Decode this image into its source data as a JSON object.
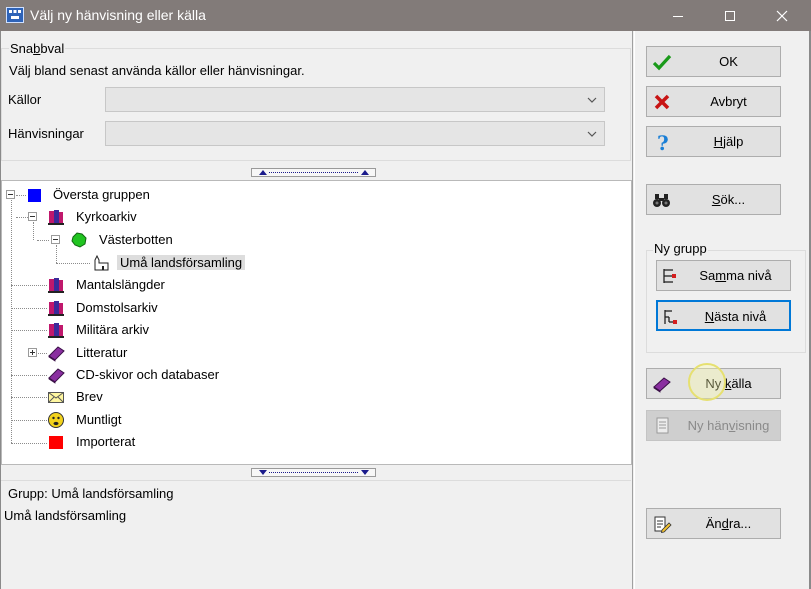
{
  "window": {
    "title": "Välj ny hänvisning eller källa"
  },
  "snabbval": {
    "legend_before": "Sna",
    "legend_mnemonic": "b",
    "legend_after": "bval",
    "hint": "Välj bland senast använda källor eller hänvisningar.",
    "kallor_label": "Källor",
    "kallor_value": "",
    "hanvisningar_label": "Hänvisningar",
    "hanvisningar_value": ""
  },
  "tree": {
    "items": [
      {
        "label": "Översta gruppen",
        "icon": "blue-square-icon"
      },
      {
        "label": "Kyrkoarkiv",
        "icon": "books-icon"
      },
      {
        "label": "Västerbotten",
        "icon": "region-map-icon"
      },
      {
        "label": "Umå landsförsamling",
        "icon": "church-icon"
      },
      {
        "label": "Mantalslängder",
        "icon": "books-icon"
      },
      {
        "label": "Domstolsarkiv",
        "icon": "books-icon"
      },
      {
        "label": "Militära arkiv",
        "icon": "books-icon"
      },
      {
        "label": "Litteratur",
        "icon": "book-icon"
      },
      {
        "label": "CD-skivor och databaser",
        "icon": "book-icon"
      },
      {
        "label": "Brev",
        "icon": "envelope-icon"
      },
      {
        "label": "Muntligt",
        "icon": "face-icon"
      },
      {
        "label": "Importerat",
        "icon": "red-square-icon"
      }
    ]
  },
  "info": {
    "group_line": "Grupp: Umå landsförsamling",
    "detail": "Umå landsförsamling"
  },
  "buttons": {
    "ok": "OK",
    "avbryt": "Avbryt",
    "hjalp_mnemonic": "H",
    "hjalp_rest": "jälp",
    "sok_mnemonic": "S",
    "sok_rest": "ök...",
    "nygrupp_legend": "Ny grupp",
    "samma_before": "Sa",
    "samma_mnemonic": "m",
    "samma_after": "ma nivå",
    "nasta_before": "",
    "nasta_mnemonic": "N",
    "nasta_after": "ästa nivå",
    "nykalla_before": "Ny ",
    "nykalla_mnemonic": "k",
    "nykalla_after": "älla",
    "nyhanv_before": "Ny hän",
    "nyhanv_mnemonic": "v",
    "nyhanv_after": "isning",
    "andra_before": "Än",
    "andra_mnemonic": "d",
    "andra_after": "ra..."
  },
  "colors": {
    "titlebar": "#827b79",
    "focus_blue": "#0078d7",
    "ok_green": "#1a9a1a",
    "cancel_red": "#c81414",
    "help_blue": "#1a7fd6"
  }
}
